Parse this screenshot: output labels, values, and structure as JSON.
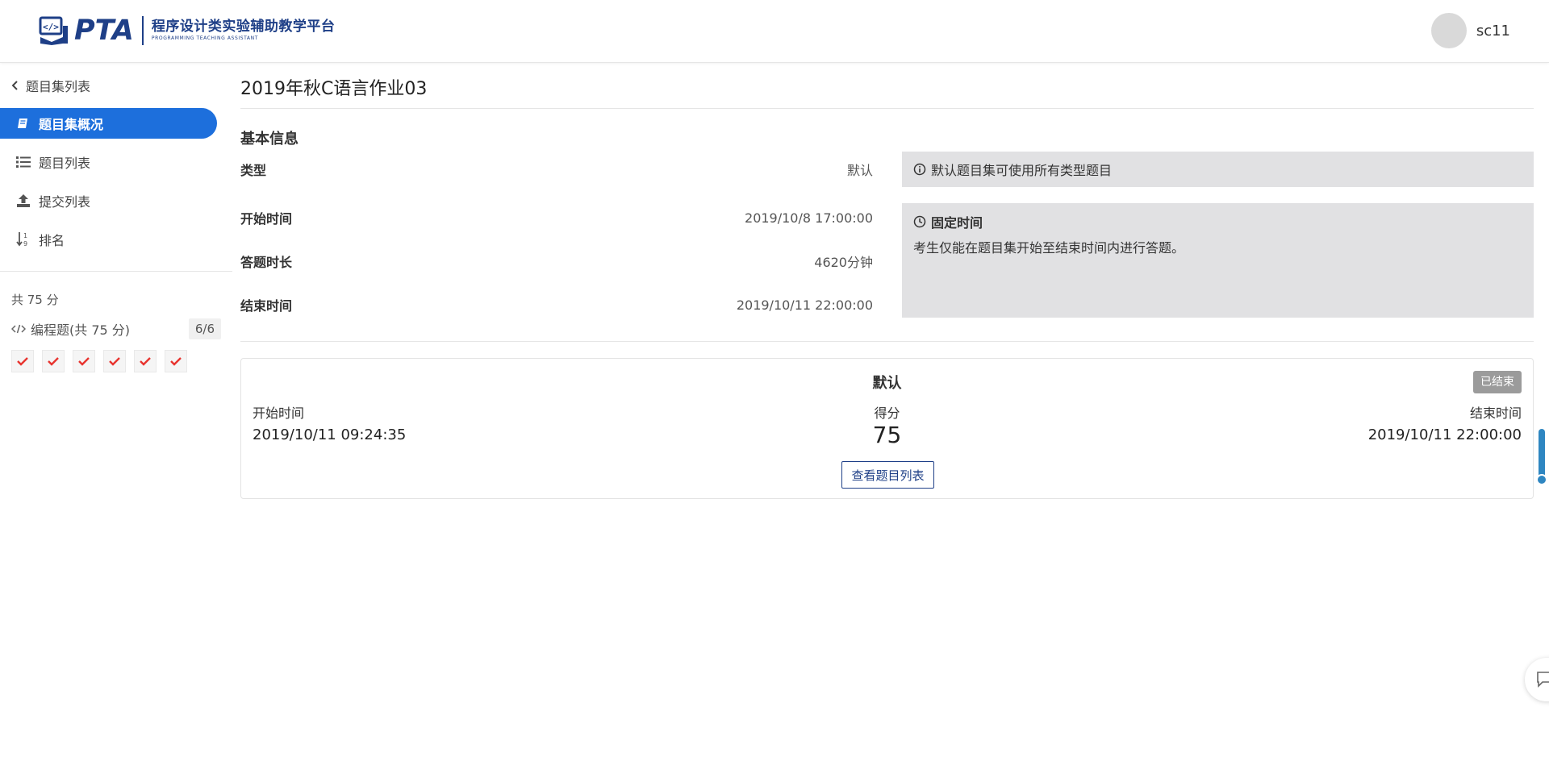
{
  "brand": {
    "name": "PTA",
    "title_cn": "程序设计类实验辅助教学平台",
    "title_en": "PROGRAMMING TEACHING ASSISTANT",
    "color": "#1e3f87"
  },
  "user": {
    "name": "sc11"
  },
  "sidebar": {
    "back_label": "题目集列表",
    "items": [
      {
        "label": "题目集概况",
        "icon": "book-icon",
        "active": true
      },
      {
        "label": "题目列表",
        "icon": "list-icon",
        "active": false
      },
      {
        "label": "提交列表",
        "icon": "upload-icon",
        "active": false
      },
      {
        "label": "排名",
        "icon": "sort-icon",
        "active": false
      }
    ],
    "total_score": "共 75 分",
    "programming_label": "编程题(共 75 分)",
    "programming_count": "6/6",
    "problem_status": [
      "correct",
      "correct",
      "correct",
      "correct",
      "correct",
      "correct"
    ],
    "accent": "#1d6fdc",
    "check_color": "#e8342f"
  },
  "main": {
    "title": "2019年秋C语言作业03",
    "section_title": "基本信息",
    "type": {
      "label": "类型",
      "value": "默认"
    },
    "type_note": "默认题目集可使用所有类型题目",
    "start": {
      "label": "开始时间",
      "value": "2019/10/8 17:00:00"
    },
    "duration": {
      "label": "答题时长",
      "value": "4620分钟"
    },
    "end": {
      "label": "结束时间",
      "value": "2019/10/11 22:00:00"
    },
    "time_note_title": "固定时间",
    "time_note_body": "考生仅能在题目集开始至结束时间内进行答题。"
  },
  "card": {
    "title": "默认",
    "badge": "已结束",
    "start_label": "开始时间",
    "start_value": "2019/10/11 09:24:35",
    "score_label": "得分",
    "score_value": "75",
    "end_label": "结束时间",
    "end_value": "2019/10/11 22:00:00",
    "button": "查看题目列表"
  }
}
